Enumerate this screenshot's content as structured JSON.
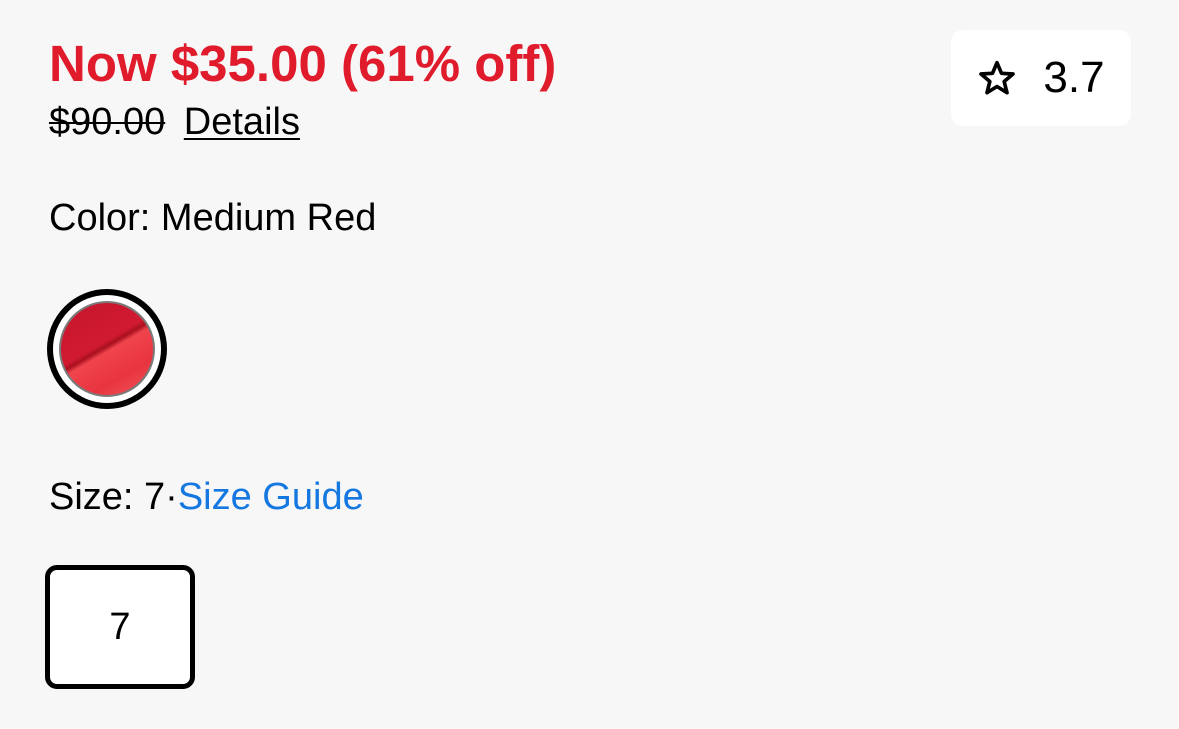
{
  "price": {
    "now_label": "Now $35.00 (61% off)",
    "was": "$90.00",
    "details_link": "Details"
  },
  "rating": {
    "icon": "star-outline-icon",
    "value": "3.7"
  },
  "color": {
    "label": "Color: Medium Red",
    "swatches": [
      {
        "name": "Medium Red",
        "selected": true,
        "hex": "#d11a32"
      }
    ]
  },
  "size": {
    "label": "Size: 7",
    "separator": "·",
    "guide_link": "Size Guide",
    "options": [
      {
        "label": "7",
        "selected": true
      }
    ]
  },
  "colors": {
    "sale_price": "#e01b2c",
    "link_blue": "#1478e0",
    "background": "#f7f7f7"
  }
}
